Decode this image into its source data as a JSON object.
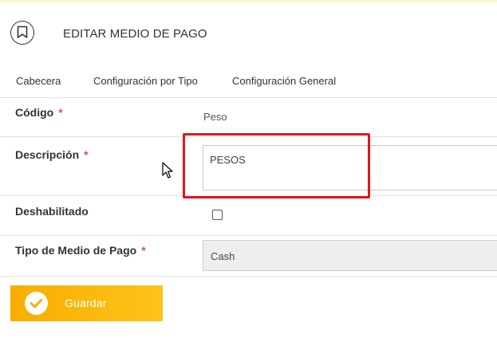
{
  "header": {
    "title": "EDITAR MEDIO DE PAGO",
    "icon": "bookmark-icon"
  },
  "tabs": [
    {
      "label": "Cabecera"
    },
    {
      "label": "Configuración por Tipo"
    },
    {
      "label": "Configuración General"
    }
  ],
  "form": {
    "required_marker": "*",
    "codigo": {
      "label": "Código",
      "value": "Peso"
    },
    "descripcion": {
      "label": "Descripción",
      "value": "PESOS"
    },
    "deshabilitado": {
      "label": "Deshabilitado",
      "checked": false
    },
    "tipo": {
      "label": "Tipo de Medio de Pago",
      "value": "Cash"
    }
  },
  "actions": {
    "save_label": "Guardar",
    "save_icon": "check-icon"
  },
  "colors": {
    "accent": "#f7ad00",
    "highlight": "#e0151b",
    "required": "#d9534f"
  }
}
